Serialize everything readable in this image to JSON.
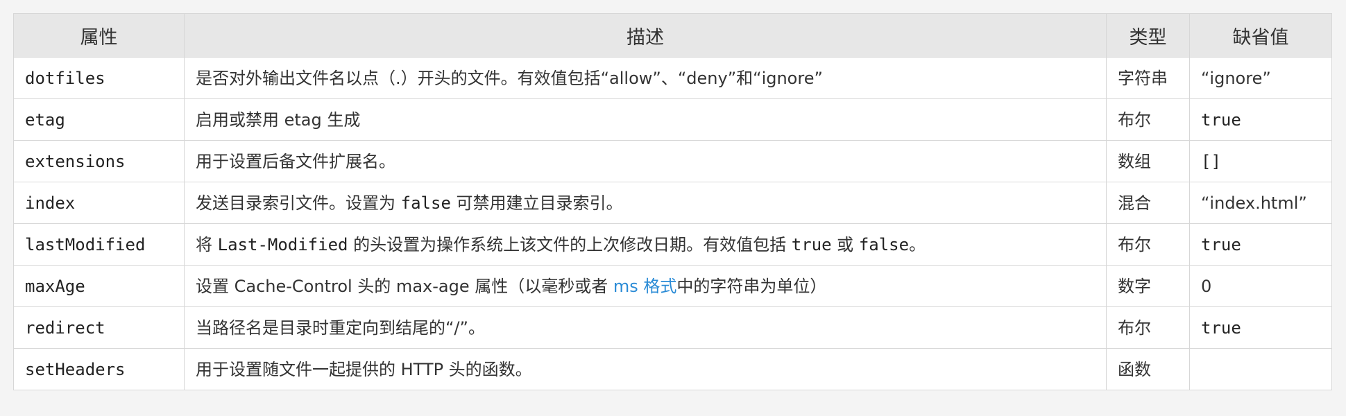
{
  "table": {
    "headers": {
      "property": "属性",
      "description": "描述",
      "type": "类型",
      "default": "缺省值"
    },
    "rows": [
      {
        "name": "dotfiles",
        "desc": [
          {
            "t": "是否对外输出文件名以点（.）开头的文件。有效值包括“allow”、“deny”和“ignore”"
          }
        ],
        "type": "字符串",
        "default": "“ignore”",
        "default_code": false
      },
      {
        "name": "etag",
        "desc": [
          {
            "t": "启用或禁用 etag 生成"
          }
        ],
        "type": "布尔",
        "default": "true",
        "default_code": true
      },
      {
        "name": "extensions",
        "desc": [
          {
            "t": "用于设置后备文件扩展名。"
          }
        ],
        "type": "数组",
        "default": "[]",
        "default_code": true
      },
      {
        "name": "index",
        "desc": [
          {
            "t": "发送目录索引文件。设置为 "
          },
          {
            "t": "false",
            "code": true
          },
          {
            "t": " 可禁用建立目录索引。"
          }
        ],
        "type": "混合",
        "default": "“index.html”",
        "default_code": false
      },
      {
        "name": "lastModified",
        "desc": [
          {
            "t": "将 "
          },
          {
            "t": "Last-Modified",
            "code": true
          },
          {
            "t": " 的头设置为操作系统上该文件的上次修改日期。有效值包括 "
          },
          {
            "t": "true",
            "code": true
          },
          {
            "t": " 或 "
          },
          {
            "t": "false",
            "code": true
          },
          {
            "t": "。"
          }
        ],
        "type": "布尔",
        "default": "true",
        "default_code": true
      },
      {
        "name": "maxAge",
        "desc": [
          {
            "t": "设置 Cache-Control 头的 max-age 属性（以毫秒或者 "
          },
          {
            "t": "ms 格式",
            "link": true
          },
          {
            "t": "中的字符串为单位）"
          }
        ],
        "type": "数字",
        "default": "0",
        "default_code": false
      },
      {
        "name": "redirect",
        "desc": [
          {
            "t": "当路径名是目录时重定向到结尾的“/”。"
          }
        ],
        "type": "布尔",
        "default": "true",
        "default_code": true
      },
      {
        "name": "setHeaders",
        "desc": [
          {
            "t": "用于设置随文件一起提供的 HTTP 头的函数。"
          }
        ],
        "type": "函数",
        "default": "",
        "default_code": false
      }
    ]
  },
  "colors": {
    "header_bg": "#e7e7e7",
    "border": "#d7d7d7",
    "link": "#2a8bd6",
    "page_bg": "#f4f4f4"
  }
}
